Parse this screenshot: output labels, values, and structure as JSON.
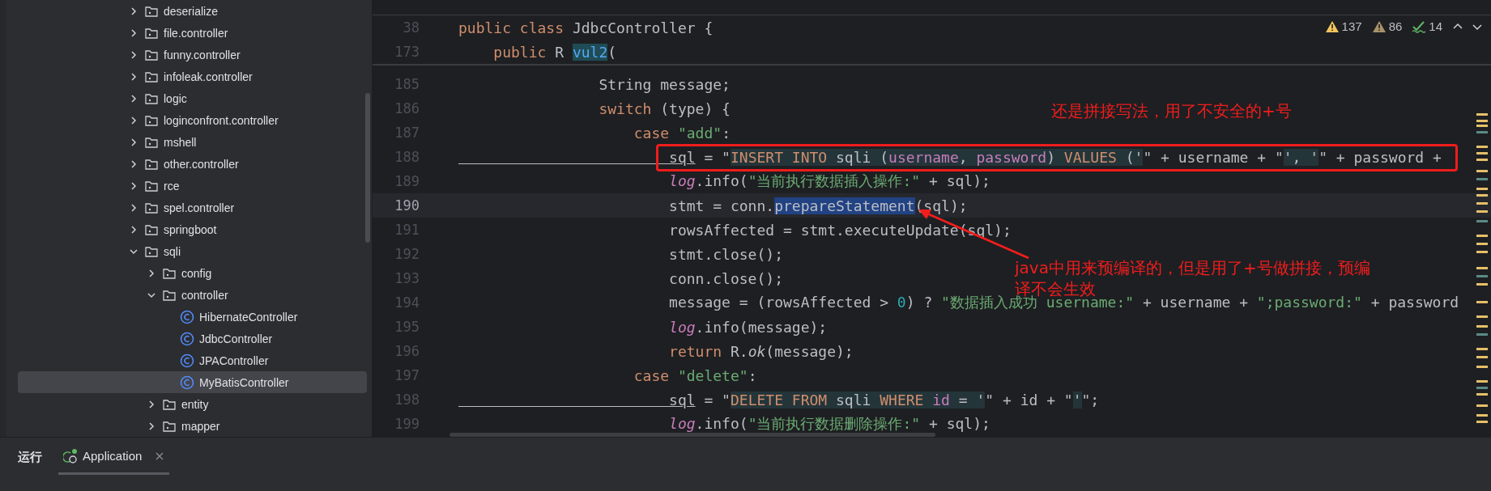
{
  "project_tree": {
    "items": [
      {
        "label": "deserialize",
        "kind": "folder",
        "expanded": false,
        "selected": false
      },
      {
        "label": "file.controller",
        "kind": "folder",
        "expanded": false,
        "selected": false
      },
      {
        "label": "funny.controller",
        "kind": "folder",
        "expanded": false,
        "selected": false
      },
      {
        "label": "infoleak.controller",
        "kind": "folder",
        "expanded": false,
        "selected": false
      },
      {
        "label": "logic",
        "kind": "folder",
        "expanded": false,
        "selected": false
      },
      {
        "label": "loginconfront.controller",
        "kind": "folder",
        "expanded": false,
        "selected": false
      },
      {
        "label": "mshell",
        "kind": "folder",
        "expanded": false,
        "selected": false
      },
      {
        "label": "other.controller",
        "kind": "folder",
        "expanded": false,
        "selected": false
      },
      {
        "label": "rce",
        "kind": "folder",
        "expanded": false,
        "selected": false
      },
      {
        "label": "spel.controller",
        "kind": "folder",
        "expanded": false,
        "selected": false
      },
      {
        "label": "springboot",
        "kind": "folder",
        "expanded": false,
        "selected": false
      },
      {
        "label": "sqli",
        "kind": "folder",
        "expanded": true,
        "selected": false,
        "children": [
          {
            "label": "config",
            "kind": "folder",
            "expanded": false,
            "selected": false
          },
          {
            "label": "controller",
            "kind": "folder",
            "expanded": true,
            "selected": false,
            "children": [
              {
                "label": "HibernateController",
                "kind": "class",
                "selected": false
              },
              {
                "label": "JdbcController",
                "kind": "class",
                "selected": false
              },
              {
                "label": "JPAController",
                "kind": "class",
                "selected": false
              },
              {
                "label": "MyBatisController",
                "kind": "class",
                "selected": true
              }
            ]
          },
          {
            "label": "entity",
            "kind": "folder",
            "expanded": false,
            "selected": false
          },
          {
            "label": "mapper",
            "kind": "folder",
            "expanded": false,
            "selected": false
          }
        ]
      }
    ]
  },
  "editor": {
    "inspections": [
      {
        "kind": "warning",
        "count": "137"
      },
      {
        "kind": "weak-warning",
        "count": "86"
      },
      {
        "kind": "typo",
        "count": "14"
      }
    ],
    "sticky_lines": [
      {
        "number": "38",
        "current": false,
        "tokens": [
          {
            "t": "public class ",
            "kind": "kw"
          },
          {
            "t": "JdbcController {",
            "kind": "plain"
          }
        ]
      },
      {
        "number": "173",
        "current": false,
        "tokens": [
          {
            "t": "    public ",
            "kind": "kw"
          },
          {
            "t": "R ",
            "kind": "plain"
          },
          {
            "t": "vul2",
            "kind": "decl"
          },
          {
            "t": "(",
            "kind": "plain"
          }
        ]
      }
    ],
    "lines": [
      {
        "number": "185",
        "current": false,
        "tokens": [
          {
            "t": "                String message;",
            "kind": "plain"
          }
        ]
      },
      {
        "number": "186",
        "current": false,
        "tokens": [
          {
            "t": "                switch ",
            "kind": "kw"
          },
          {
            "t": "(type) {",
            "kind": "plain"
          }
        ]
      },
      {
        "number": "187",
        "current": false,
        "tokens": [
          {
            "t": "                    case ",
            "kind": "kw"
          },
          {
            "t": "\"add\"",
            "kind": "str"
          },
          {
            "t": ":",
            "kind": "plain"
          }
        ]
      },
      {
        "number": "188",
        "current": false,
        "tokens": [
          {
            "t": "                        sql",
            "kind": "var"
          },
          {
            "t": " = \"",
            "kind": "plain"
          },
          {
            "t": "INSERT INTO ",
            "kind": "sqlkw"
          },
          {
            "t": "sqli (",
            "kind": "sql"
          },
          {
            "t": "username",
            "kind": "sqlcol"
          },
          {
            "t": ", ",
            "kind": "sql"
          },
          {
            "t": "password",
            "kind": "sqlcol"
          },
          {
            "t": ") ",
            "kind": "sql"
          },
          {
            "t": "VALUES",
            "kind": "sqlkw"
          },
          {
            "t": " ('",
            "kind": "sql"
          },
          {
            "t": "\" + username + \"",
            "kind": "plain"
          },
          {
            "t": "', '",
            "kind": "sql"
          },
          {
            "t": "\" + password +",
            "kind": "plain"
          }
        ]
      },
      {
        "number": "189",
        "current": false,
        "tokens": [
          {
            "t": "                        log",
            "kind": "field"
          },
          {
            "t": ".info(",
            "kind": "plain"
          },
          {
            "t": "\"当前执行数据插入操作:\"",
            "kind": "str"
          },
          {
            "t": " + sql);",
            "kind": "plain"
          }
        ]
      },
      {
        "number": "190",
        "current": true,
        "tokens": [
          {
            "t": "                        stmt = conn.",
            "kind": "plain"
          },
          {
            "t": "prepareStatement",
            "kind": "sel"
          },
          {
            "t": "(sql);",
            "kind": "plain"
          }
        ]
      },
      {
        "number": "191",
        "current": false,
        "tokens": [
          {
            "t": "                        rowsAffected = stmt.executeUpdate(sql);",
            "kind": "plain"
          }
        ]
      },
      {
        "number": "192",
        "current": false,
        "tokens": [
          {
            "t": "                        stmt.close();",
            "kind": "plain"
          }
        ]
      },
      {
        "number": "193",
        "current": false,
        "tokens": [
          {
            "t": "                        conn.close();",
            "kind": "plain"
          }
        ]
      },
      {
        "number": "194",
        "current": false,
        "tokens": [
          {
            "t": "                        message = (rowsAffected > ",
            "kind": "plain"
          },
          {
            "t": "0",
            "kind": "num"
          },
          {
            "t": ") ? ",
            "kind": "plain"
          },
          {
            "t": "\"数据插入成功 username:\"",
            "kind": "str"
          },
          {
            "t": " + username + ",
            "kind": "plain"
          },
          {
            "t": "\";password:\"",
            "kind": "str"
          },
          {
            "t": " + password",
            "kind": "plain"
          }
        ]
      },
      {
        "number": "195",
        "current": false,
        "tokens": [
          {
            "t": "                        log",
            "kind": "field"
          },
          {
            "t": ".info(message);",
            "kind": "plain"
          }
        ]
      },
      {
        "number": "196",
        "current": false,
        "tokens": [
          {
            "t": "                        return ",
            "kind": "kw"
          },
          {
            "t": "R.",
            "kind": "plain"
          },
          {
            "t": "ok",
            "kind": "italic"
          },
          {
            "t": "(message);",
            "kind": "plain"
          }
        ]
      },
      {
        "number": "197",
        "current": false,
        "tokens": [
          {
            "t": "                    case ",
            "kind": "kw"
          },
          {
            "t": "\"delete\"",
            "kind": "str"
          },
          {
            "t": ":",
            "kind": "plain"
          }
        ]
      },
      {
        "number": "198",
        "current": false,
        "tokens": [
          {
            "t": "                        sql",
            "kind": "var"
          },
          {
            "t": " = \"",
            "kind": "plain"
          },
          {
            "t": "DELETE FROM ",
            "kind": "sqlkw"
          },
          {
            "t": "sqli ",
            "kind": "sql"
          },
          {
            "t": "WHERE ",
            "kind": "sqlkw"
          },
          {
            "t": "id",
            "kind": "sqlcol"
          },
          {
            "t": " = '",
            "kind": "sql"
          },
          {
            "t": "\" + id + \"",
            "kind": "plain"
          },
          {
            "t": "'",
            "kind": "sql"
          },
          {
            "t": "\";",
            "kind": "plain"
          }
        ]
      },
      {
        "number": "199",
        "current": false,
        "tokens": [
          {
            "t": "                        log",
            "kind": "field"
          },
          {
            "t": ".info(",
            "kind": "plain"
          },
          {
            "t": "\"当前执行数据删除操作:\"",
            "kind": "str"
          },
          {
            "t": " + sql);",
            "kind": "plain"
          }
        ]
      }
    ]
  },
  "annotations": [
    {
      "kind": "note",
      "text": "还是拼接写法，用了不安全的+号"
    },
    {
      "kind": "note",
      "text": "java中用来预编译的，但是用了+号做拼接，预编译不会生效"
    }
  ],
  "bottom_panel": {
    "title": "运行",
    "tabs": [
      {
        "label": "Application",
        "selected": true
      }
    ]
  }
}
